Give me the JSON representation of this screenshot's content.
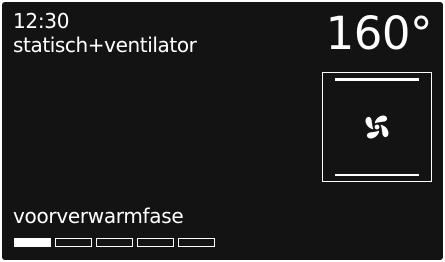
{
  "status": {
    "time": "12:30",
    "mode": "statisch+ventilator",
    "temperature": "160°"
  },
  "oven_icon": {
    "icon": "oven-fan-with-top-bottom-heat-icon"
  },
  "phase": {
    "label": "voorverwarmfase",
    "progress_segments_total": 5,
    "progress_segments_filled": 1
  },
  "colors": {
    "background": "#131313",
    "foreground": "#ffffff"
  }
}
